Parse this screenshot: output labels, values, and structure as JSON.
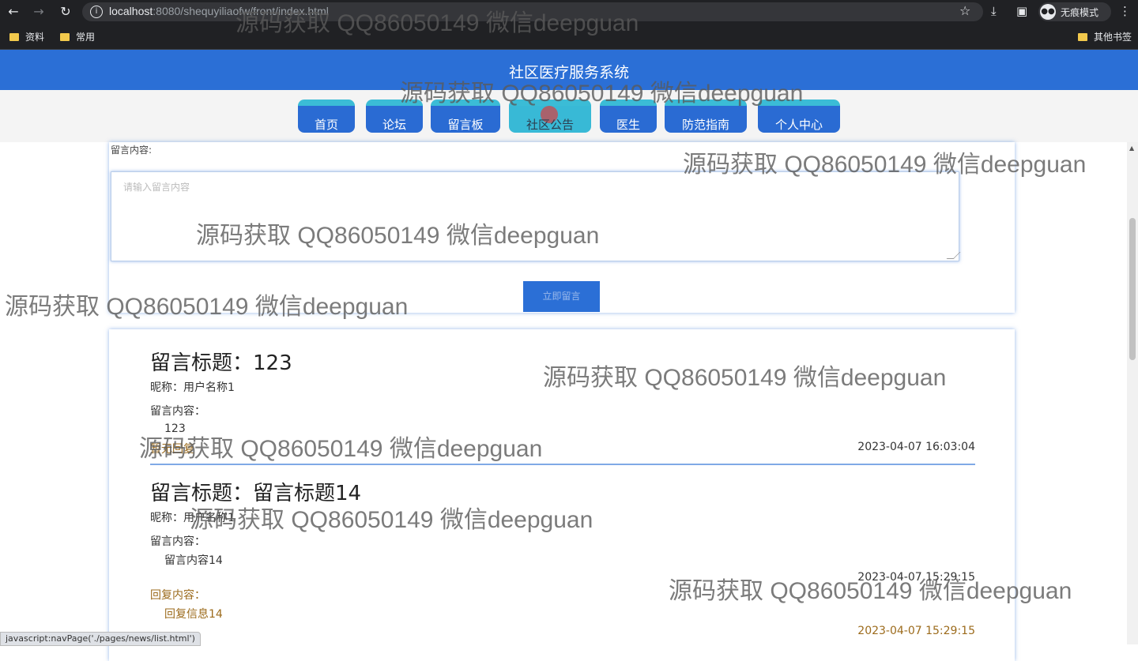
{
  "browser": {
    "url_host": "localhost",
    "url_rest": ":8080/shequyiliaofw/front/index.html",
    "incognito_label": "无痕模式",
    "bookmarks": [
      "资料",
      "常用"
    ],
    "other_bookmarks": "其他书签",
    "status_text": "javascript:navPage('./pages/news/list.html')"
  },
  "site": {
    "title": "社区医疗服务系统",
    "menu": [
      "首页",
      "论坛",
      "留言板",
      "社区公告",
      "医生",
      "防范指南",
      "个人中心"
    ],
    "active_menu": "社区公告"
  },
  "form": {
    "content_label": "留言内容:",
    "content_placeholder": "请输入留言内容",
    "submit_label": "立即留言"
  },
  "messages": [
    {
      "title": "留言标题：123",
      "nickname": "昵称：用户名称1",
      "content_label": "留言内容：",
      "content": "123",
      "reply_button": "暂无回复",
      "time": "2023-04-07 16:03:04"
    },
    {
      "title": "留言标题：留言标题14",
      "nickname": "昵称：用户名称1",
      "content_label": "留言内容：",
      "content": "留言内容14",
      "time": "2023-04-07 15:29:15",
      "reply_label": "回复内容：",
      "reply": "回复信息14",
      "reply_time": "2023-04-07 15:29:15"
    }
  ],
  "watermark": "源码获取 QQ86050149 微信deepguan",
  "colors": {
    "header_blue": "#2b6fd6",
    "menu_accent": "#3bbcd6",
    "reply_brown": "#9c6b1c"
  }
}
